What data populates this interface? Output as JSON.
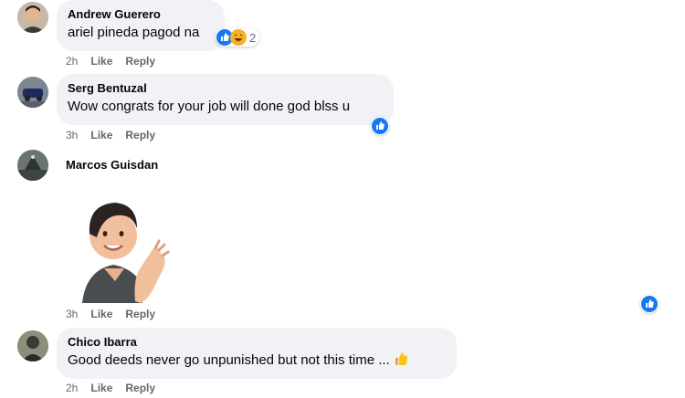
{
  "comments": [
    {
      "author": "Andrew Guerero",
      "text": "ariel pineda pagod na",
      "reactions": {
        "icons": [
          "like-icon",
          "haha-icon"
        ],
        "count": "2"
      },
      "time": "2h",
      "like_label": "Like",
      "reply_label": "Reply"
    },
    {
      "author": "Serg Bentuzal",
      "text": "Wow congrats for your job will done god blss u",
      "reactions": {
        "icons": [
          "like-icon"
        ]
      },
      "time": "3h",
      "like_label": "Like",
      "reply_label": "Reply"
    },
    {
      "author": "Marcos Guisdan",
      "sticker": "clapping-avatar-sticker",
      "reactions": {
        "icons": [
          "like-icon"
        ]
      },
      "time": "3h",
      "like_label": "Like",
      "reply_label": "Reply"
    },
    {
      "author": "Chico Ibarra",
      "text": "Good deeds never go unpunished but not this time ...",
      "emoji": "thumbs-up-emoji",
      "time": "2h",
      "like_label": "Like",
      "reply_label": "Reply"
    }
  ],
  "colors": {
    "bubble": "#f0f2f5",
    "like_blue": "#1877f2",
    "meta_gray": "#65676b",
    "haha_yellow": "#f7b125"
  }
}
